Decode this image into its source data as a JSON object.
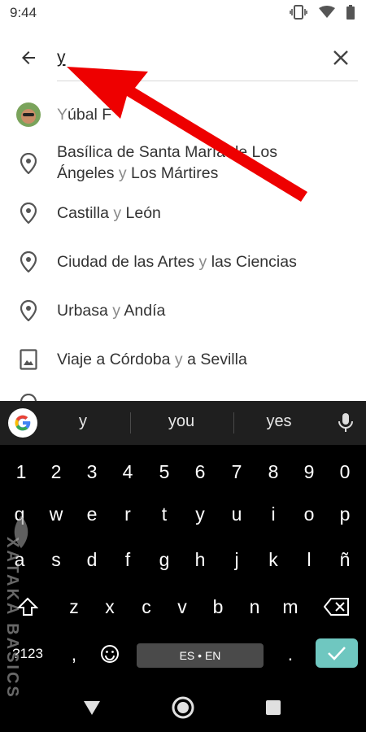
{
  "status_bar": {
    "time": "9:44"
  },
  "search": {
    "value": "y"
  },
  "suggestions": [
    {
      "type": "contact",
      "prefix": "",
      "match": "Y",
      "rest": "úbal F"
    },
    {
      "type": "place",
      "line1": "Basílica de Santa María de Los",
      "line2_pre": "Ángeles ",
      "line2_match": "y",
      "line2_post": " Los Mártires"
    },
    {
      "type": "place",
      "pre": "Castilla ",
      "match": "y",
      "post": " León"
    },
    {
      "type": "place",
      "pre": "Ciudad de las Artes ",
      "match": "y",
      "post": " las Ciencias"
    },
    {
      "type": "place",
      "pre": "Urbasa ",
      "match": "y",
      "post": " Andía"
    },
    {
      "type": "album",
      "pre": "Viaje a Córdoba ",
      "match": "y",
      "post": " a Sevilla"
    }
  ],
  "keyboard": {
    "suggestions": [
      "y",
      "you",
      "yes"
    ],
    "row_numbers": [
      "1",
      "2",
      "3",
      "4",
      "5",
      "6",
      "7",
      "8",
      "9",
      "0"
    ],
    "row_top": [
      "q",
      "w",
      "e",
      "r",
      "t",
      "y",
      "u",
      "i",
      "o",
      "p"
    ],
    "row_home": [
      "a",
      "s",
      "d",
      "f",
      "g",
      "h",
      "j",
      "k",
      "l",
      "ñ"
    ],
    "row_bottom": [
      "z",
      "x",
      "c",
      "v",
      "b",
      "n",
      "m"
    ],
    "symbols_key": "?123",
    "comma_key": ",",
    "period_key": ".",
    "space_label": "ES • EN"
  },
  "watermark": {
    "text": "XATAKA BASICS"
  },
  "colors": {
    "accent": "#6fc7c0",
    "arrow": "#ee0000",
    "keyboard_bg": "#000000"
  }
}
